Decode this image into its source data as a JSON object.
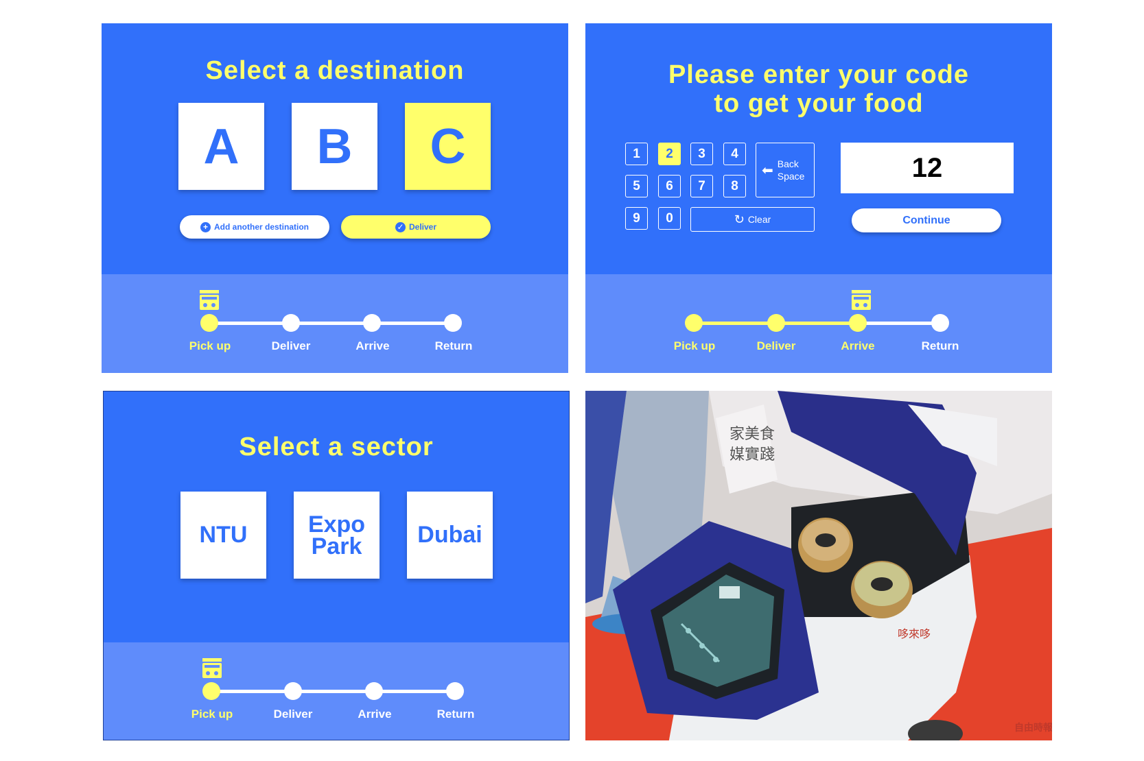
{
  "panel_destination": {
    "title": "Select a destination",
    "options": [
      "A",
      "B",
      "C"
    ],
    "selected": "C",
    "add_label": "Add another destination",
    "deliver_label": "Deliver"
  },
  "panel_code": {
    "title_line1": "Please enter your code",
    "title_line2": "to get your food",
    "keys": [
      "1",
      "2",
      "3",
      "4",
      "5",
      "6",
      "7",
      "8",
      "9",
      "0"
    ],
    "pressed_key": "2",
    "backspace_line1": "Back",
    "backspace_line2": "Space",
    "clear_label": "Clear",
    "code_value": "12",
    "continue_label": "Continue"
  },
  "panel_sector": {
    "title": "Select a sector",
    "options": [
      "NTU",
      "Expo Park",
      "Dubai"
    ]
  },
  "progress_steps": [
    "Pick up",
    "Deliver",
    "Arrive",
    "Return"
  ],
  "progress_current": {
    "destination": 1,
    "code": 3,
    "sector": 1
  },
  "photo": {
    "watermark": "自由時報"
  },
  "colors": {
    "primary_blue": "#3170fa",
    "light_blue": "#5f8cfb",
    "accent_yellow": "#ffff6b"
  },
  "icons": [
    "plus-circle-icon",
    "check-circle-icon",
    "left-arrow-icon",
    "refresh-icon",
    "delivery-robot-icon"
  ]
}
